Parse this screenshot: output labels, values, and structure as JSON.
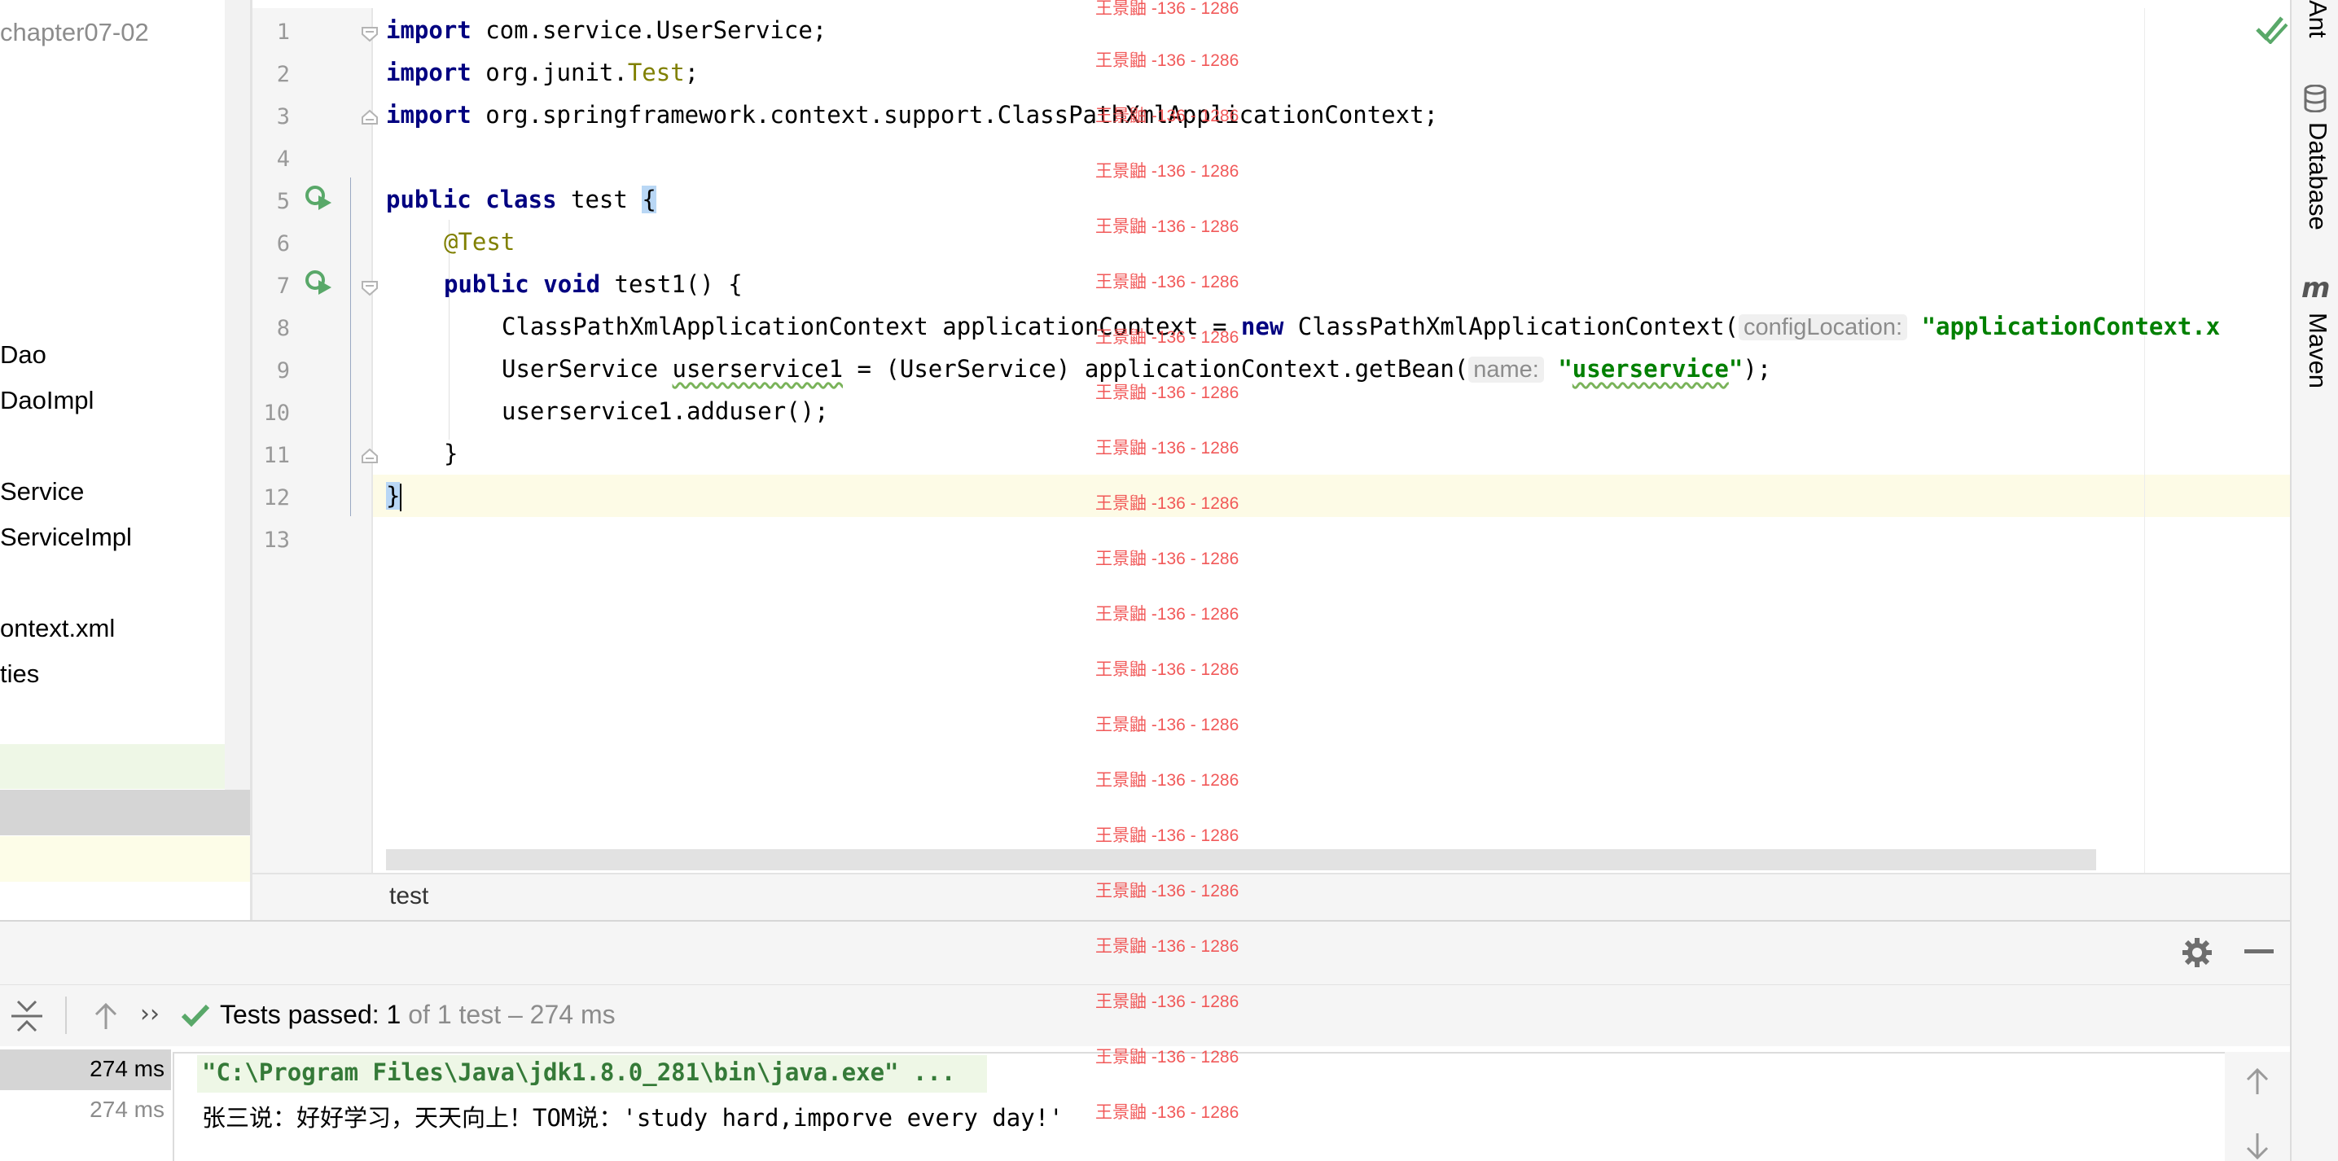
{
  "project_tree": {
    "root": "chapter07-02",
    "items": [
      "Dao",
      "DaoImpl",
      "Service",
      "ServiceImpl",
      "ontext.xml",
      "ties"
    ]
  },
  "editor": {
    "line_numbers": [
      "1",
      "2",
      "3",
      "4",
      "5",
      "6",
      "7",
      "8",
      "9",
      "10",
      "11",
      "12",
      "13"
    ],
    "line1": {
      "kw": "import",
      "rest": " com.service.UserService;"
    },
    "line2": {
      "kw": "import",
      "pkg": " org.junit.",
      "ann": "Test",
      "end": ";"
    },
    "line3": {
      "kw": "import",
      "rest": " org.springframework.context.support.ClassPathXmlApplicationContext;"
    },
    "line5": {
      "kw1": "public",
      "kw2": "class",
      "name": " test ",
      "brace": "{"
    },
    "line6": {
      "ann": "@Test"
    },
    "line7": {
      "kw1": "public",
      "kw2": "void",
      "rest": " test1() {"
    },
    "line8": {
      "pre": "ClassPathXmlApplicationContext applicationContext = ",
      "kw": "new",
      "post": " ClassPathXmlApplicationContext(",
      "hint": "configLocation:",
      "str": "\"applicationContext.x"
    },
    "line9": {
      "pre": "UserService ",
      "var": "userservice1",
      "mid": " = (UserService) applicationContext.getBean(",
      "hint": "name:",
      "q1": "\"",
      "str": "userservice",
      "q2": "\"",
      "end": ");"
    },
    "line10": {
      "rest": "userservice1.adduser();"
    },
    "line11": {
      "rest": "}"
    },
    "line12": {
      "rest": "}"
    }
  },
  "breadcrumb": {
    "item": "test"
  },
  "right_strip": {
    "tabs": [
      "Ant",
      "Database",
      "Maven"
    ]
  },
  "run": {
    "status_label": "Tests passed: ",
    "status_count": "1",
    "status_rest": " of 1 test – 274 ms",
    "times": [
      "274 ms",
      "274 ms"
    ],
    "console": [
      "\"C:\\Program Files\\Java\\jdk1.8.0_281\\bin\\java.exe\" ...",
      "张三说：好好学习，天天向上！TOM说：'study hard,imporve every day!'"
    ]
  },
  "watermark": "王景鼬 -136 - 1286",
  "icons": [
    "run-gutter-icon",
    "fold-icon",
    "checkmark-icon",
    "database-icon",
    "maven-icon",
    "gear-icon",
    "minimize-icon",
    "collapse-all-icon",
    "arrow-up-icon",
    "more-icon",
    "scroll-up-icon",
    "scroll-down-icon"
  ],
  "colors": {
    "keyword": "#000080",
    "annotation": "#808000",
    "string": "#008000",
    "success": "#59a869",
    "watermark": "#f04848"
  }
}
